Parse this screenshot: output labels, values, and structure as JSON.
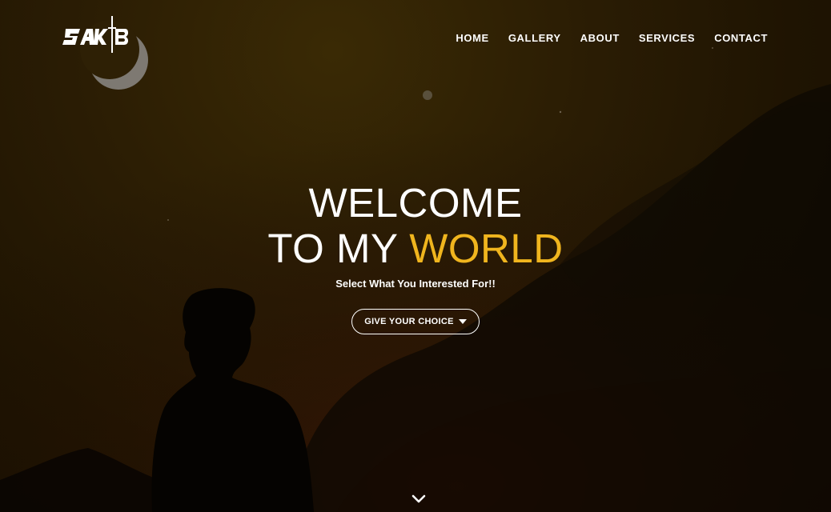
{
  "brand": {
    "logo_text": "SAKIB",
    "icon": "brand-logo-icon"
  },
  "nav": {
    "items": [
      {
        "label": "HOME"
      },
      {
        "label": "GALLERY"
      },
      {
        "label": "ABOUT"
      },
      {
        "label": "SERVICES"
      },
      {
        "label": "CONTACT"
      }
    ]
  },
  "hero": {
    "line1": "WELCOME",
    "line2_prefix": "TO MY ",
    "line2_accent": "WORLD",
    "subtitle": "Select What You Interested For!!",
    "cta_label": "GIVE YOUR CHOICE",
    "cta_icon": "caret-down-icon"
  },
  "scroll": {
    "icon": "chevron-down-icon"
  },
  "colors": {
    "accent": "#f0b51e",
    "background": "#2b1d04",
    "text": "#ffffff"
  }
}
